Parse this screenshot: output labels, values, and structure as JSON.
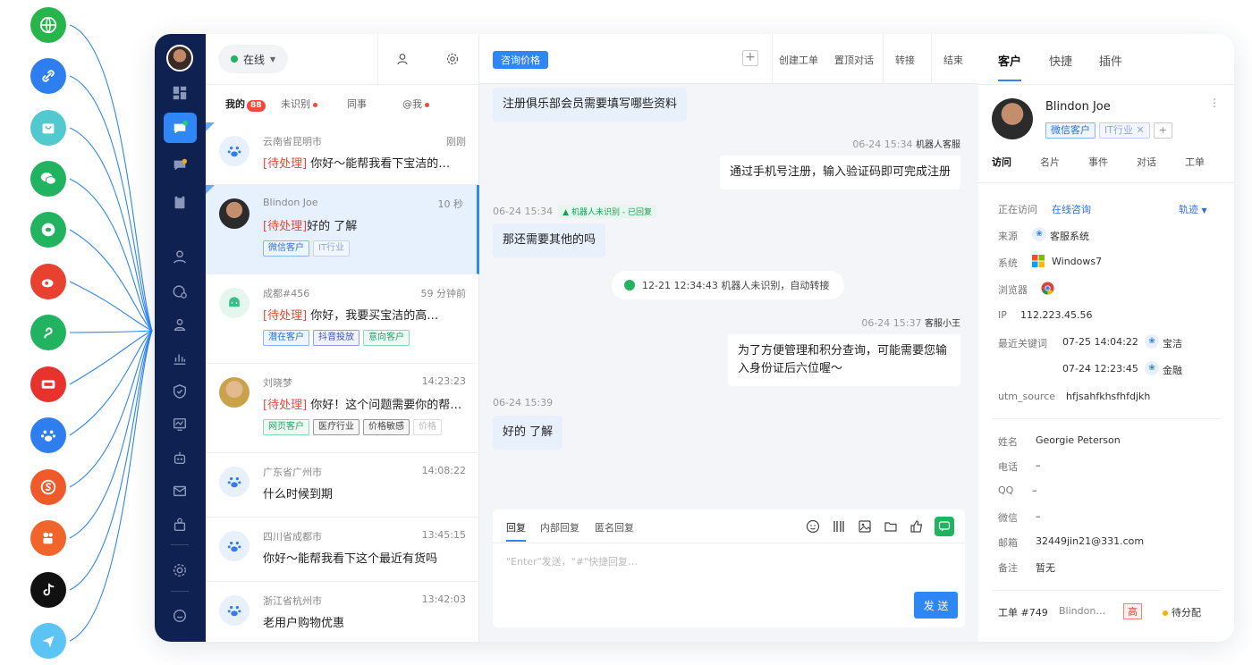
{
  "list": {
    "status": "在线",
    "tabs": {
      "mine": "我的",
      "mine_count": "88",
      "unknown": "未识别",
      "colleague": "同事",
      "mention": "@我"
    },
    "conversations": [
      {
        "location": "云南省昆明市",
        "time": "刚刚",
        "pending": "[待处理]",
        "message": "你好～能帮我看下宝洁的…"
      },
      {
        "location": "Blindon Joe",
        "time": "10 秒",
        "pending": "[待处理]",
        "message": "好的 了解",
        "tags": [
          "微信客户",
          "IT行业"
        ]
      },
      {
        "location": "成都#456",
        "time": "59 分钟前",
        "pending": "[待处理]",
        "message": "你好，我要买宝洁的高…",
        "tags": [
          "潜在客户",
          "抖音投放",
          "意向客户"
        ]
      },
      {
        "location": "刘晓梦",
        "time": "14:23:23",
        "pending": "[待处理]",
        "message": "你好！这个问题需要你的帮…",
        "tags": [
          "网页客户",
          "医疗行业",
          "价格敏感",
          "价格"
        ]
      },
      {
        "location": "广东省广州市",
        "time": "14:08:22",
        "message": "什么时候到期"
      },
      {
        "location": "四川省成都市",
        "time": "13:45:15",
        "message": "你好～能帮我看下这个最近有货吗"
      },
      {
        "location": "浙江省杭州市",
        "time": "13:42:03",
        "message": "老用户购物优惠"
      }
    ]
  },
  "chat": {
    "tag": "咨询价格",
    "actions": [
      "创建工单",
      "置顶对话",
      "转接",
      "结束"
    ],
    "messages": {
      "m1": "注册俱乐部会员需要填写哪些资料",
      "m2_meta": "06-24 15:34",
      "m2_sender": "机器人客服",
      "m2": "通过手机号注册，输入验证码即可完成注册",
      "m3_meta": "06-24 15:34",
      "m3_robot": "机器人未识别 - 已回复",
      "m3": "那还需要其他的吗",
      "sys": "12-21 12:34:43  机器人未识别，自动转接",
      "m4_meta": "06-24 15:37",
      "m4_sender": "客服小王",
      "m4": "为了方便管理和积分查询，可能需要您输入身份证后六位喔～",
      "m5_meta": "06-24 15:39",
      "m5": "好的 了解"
    },
    "composer": {
      "tabs": [
        "回复",
        "内部回复",
        "匿名回复"
      ],
      "placeholder": "\"Enter\"发送，\"#\"快捷回复…",
      "send": "发 送"
    }
  },
  "panel": {
    "tabs": [
      "客户",
      "快捷",
      "插件"
    ],
    "name": "Blindon Joe",
    "tags": [
      "微信客户",
      "IT行业"
    ],
    "subtabs": [
      "访问",
      "名片",
      "事件",
      "对话",
      "工单"
    ],
    "visit": {
      "visiting_label": "正在访问",
      "visiting": "在线咨询",
      "track": "轨迹",
      "source_label": "来源",
      "source": "客服系统",
      "system_label": "系统",
      "system": "Windows7",
      "browser_label": "浏览器",
      "ip_label": "IP",
      "ip": "112.223.45.56",
      "keyword_label": "最近关键词",
      "kw1_time": "07-25 14:04:22",
      "kw1": "宝洁",
      "kw2_time": "07-24 12:23:45",
      "kw2": "金融",
      "utm_label": "utm_source",
      "utm": "hfjsahfkhsfhfdjkh"
    },
    "profile": {
      "name_label": "姓名",
      "name": "Georgie Peterson",
      "phone_label": "电话",
      "phone": "–",
      "qq_label": "QQ",
      "qq": "–",
      "wechat_label": "微信",
      "wechat": "–",
      "email_label": "邮箱",
      "email": "32449jin21@331.com",
      "note_label": "备注",
      "note": "暂无"
    },
    "ticket": {
      "id": "工单 #749",
      "owner": "Blindon…",
      "priority": "高",
      "status": "待分配"
    }
  },
  "colors": {
    "accent": "#2f86f6",
    "nav": "#0f2150",
    "pending": "#e5483b",
    "online": "#21b35f"
  }
}
